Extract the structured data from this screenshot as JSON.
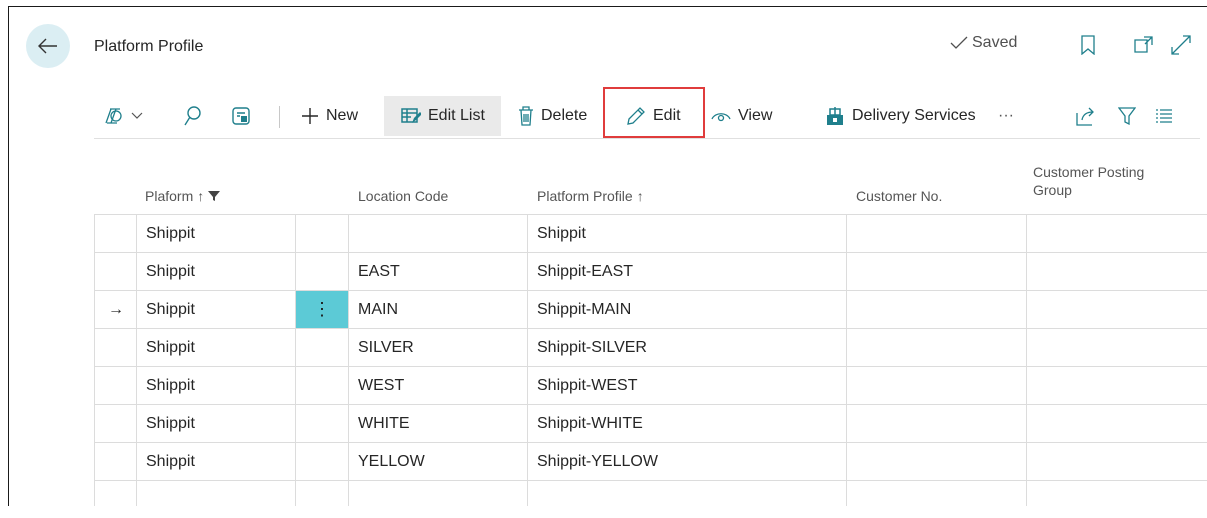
{
  "header": {
    "title": "Platform Profile",
    "saved_label": "Saved"
  },
  "toolbar": {
    "new_label": "New",
    "edit_list_label": "Edit List",
    "delete_label": "Delete",
    "edit_label": "Edit",
    "view_label": "View",
    "delivery_services_label": "Delivery Services",
    "more_label": "···"
  },
  "columns": {
    "platform": "Plaform",
    "platform_sort": "↑",
    "location_code": "Location Code",
    "platform_profile": "Platform Profile",
    "platform_profile_sort": "↑",
    "customer_no": "Customer No.",
    "customer_posting_group_line1": "Customer Posting",
    "customer_posting_group_line2": "Group"
  },
  "rows": [
    {
      "platform": "Shippit",
      "location": "",
      "profile": "Shippit",
      "customer_no": "",
      "posting_group": ""
    },
    {
      "platform": "Shippit",
      "location": "EAST",
      "profile": "Shippit-EAST",
      "customer_no": "",
      "posting_group": ""
    },
    {
      "platform": "Shippit",
      "location": "MAIN",
      "profile": "Shippit-MAIN",
      "customer_no": "",
      "posting_group": ""
    },
    {
      "platform": "Shippit",
      "location": "SILVER",
      "profile": "Shippit-SILVER",
      "customer_no": "",
      "posting_group": ""
    },
    {
      "platform": "Shippit",
      "location": "WEST",
      "profile": "Shippit-WEST",
      "customer_no": "",
      "posting_group": ""
    },
    {
      "platform": "Shippit",
      "location": "WHITE",
      "profile": "Shippit-WHITE",
      "customer_no": "",
      "posting_group": ""
    },
    {
      "platform": "Shippit",
      "location": "YELLOW",
      "profile": "Shippit-YELLOW",
      "customer_no": "",
      "posting_group": ""
    }
  ],
  "selected_row_indicator": "→",
  "row_menu_dots": "⋮",
  "colors": {
    "accent": "#5ccad6",
    "back_button_bg": "#dbeef3",
    "highlight_border": "#e03c3c"
  }
}
